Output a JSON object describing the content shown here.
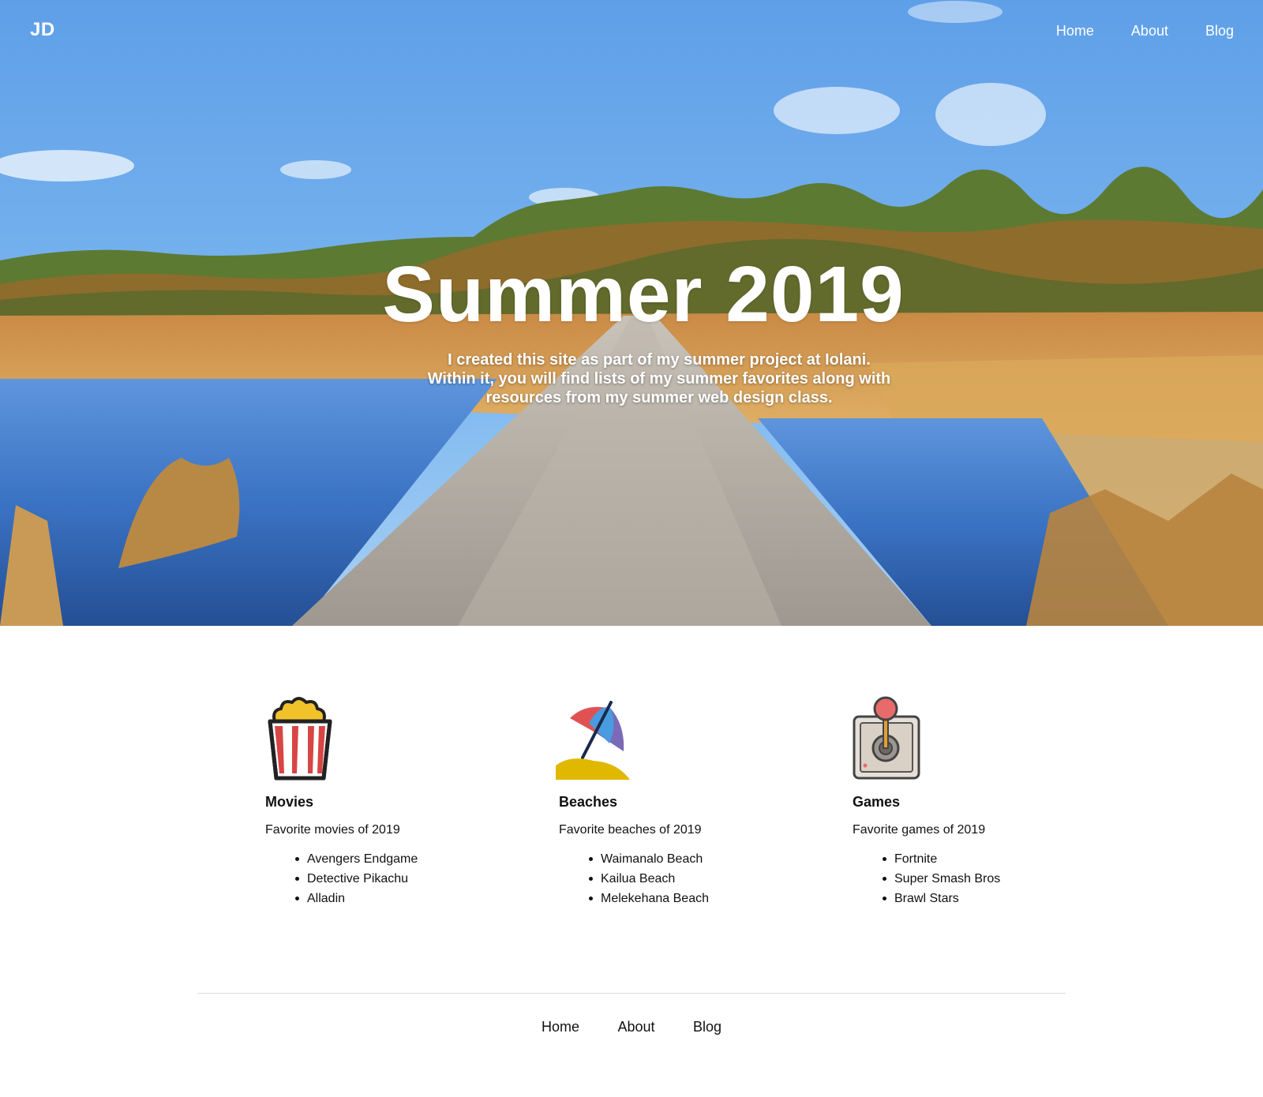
{
  "header": {
    "brand": "JD",
    "nav": [
      "Home",
      "About",
      "Blog"
    ]
  },
  "hero": {
    "title": "Summer 2019",
    "subtitle": "I created this site as part of my summer project at Iolani. Within it, you will find lists of my summer favorites along with resources from my summer web design class."
  },
  "cards": [
    {
      "icon": "popcorn-icon",
      "title": "Movies",
      "description": "Favorite movies of 2019",
      "items": [
        "Avengers Endgame",
        "Detective Pikachu",
        "Alladin"
      ]
    },
    {
      "icon": "beach-umbrella-icon",
      "title": "Beaches",
      "description": "Favorite beaches of 2019",
      "items": [
        "Waimanalo Beach",
        "Kailua Beach",
        "Melekehana Beach"
      ]
    },
    {
      "icon": "joystick-icon",
      "title": "Games",
      "description": "Favorite games of 2019",
      "items": [
        "Fortnite",
        "Super Smash Bros",
        "Brawl Stars"
      ]
    }
  ],
  "footer": {
    "nav": [
      "Home",
      "About",
      "Blog"
    ]
  },
  "colors": {
    "sky": "#6aaef0",
    "water": "#3f7fd0",
    "boardwalk": "#b8b3ab",
    "grass": "#d8a45a",
    "popcorn_red": "#d84545",
    "umbrella_red": "#e05252",
    "umbrella_blue": "#4a9be0",
    "umbrella_purple": "#7a6ab8",
    "sand": "#e0b800",
    "joystick_knob": "#e86b6b"
  }
}
